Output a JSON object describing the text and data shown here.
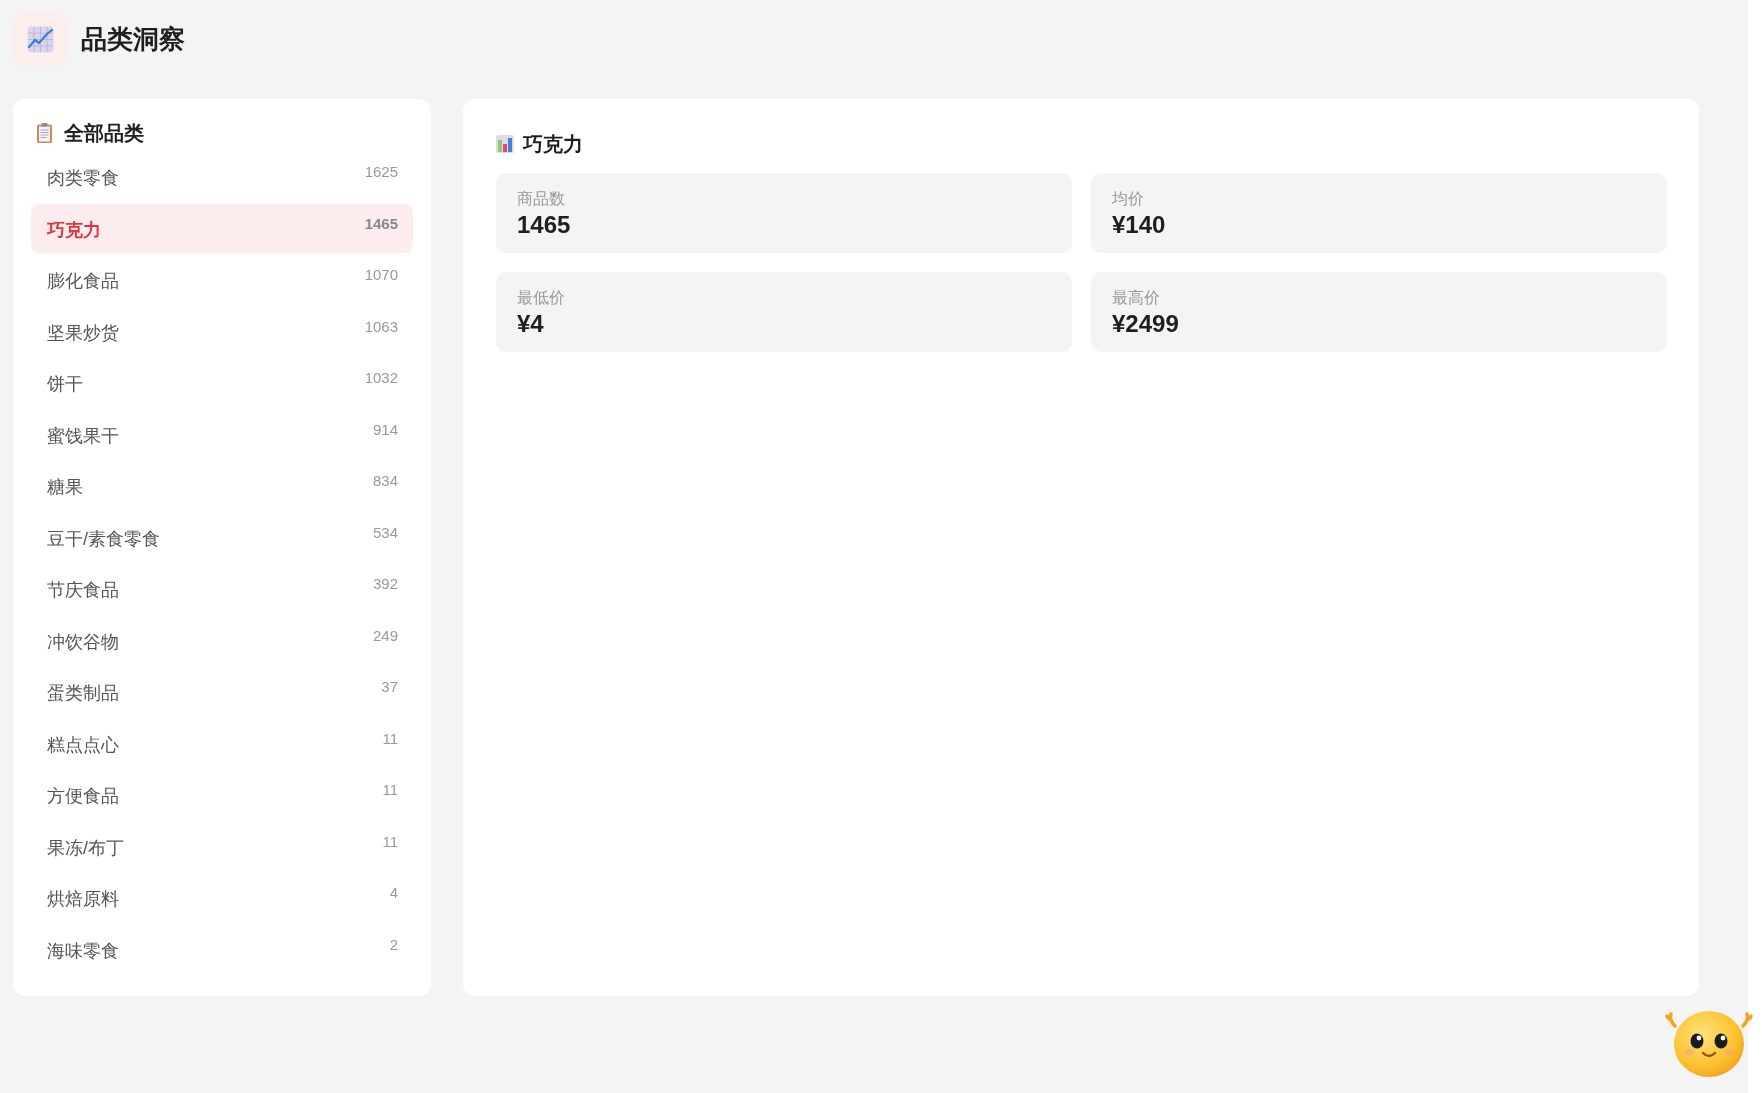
{
  "header": {
    "title": "品类洞察"
  },
  "sidebar": {
    "title": "全部品类",
    "items": [
      {
        "name": "肉类零食",
        "count": "1625",
        "selected": false
      },
      {
        "name": "巧克力",
        "count": "1465",
        "selected": true
      },
      {
        "name": "膨化食品",
        "count": "1070",
        "selected": false
      },
      {
        "name": "坚果炒货",
        "count": "1063",
        "selected": false
      },
      {
        "name": "饼干",
        "count": "1032",
        "selected": false
      },
      {
        "name": "蜜饯果干",
        "count": "914",
        "selected": false
      },
      {
        "name": "糖果",
        "count": "834",
        "selected": false
      },
      {
        "name": "豆干/素食零食",
        "count": "534",
        "selected": false
      },
      {
        "name": "节庆食品",
        "count": "392",
        "selected": false
      },
      {
        "name": "冲饮谷物",
        "count": "249",
        "selected": false
      },
      {
        "name": "蛋类制品",
        "count": "37",
        "selected": false
      },
      {
        "name": "糕点点心",
        "count": "11",
        "selected": false
      },
      {
        "name": "方便食品",
        "count": "11",
        "selected": false
      },
      {
        "name": "果冻/布丁",
        "count": "11",
        "selected": false
      },
      {
        "name": "烘焙原料",
        "count": "4",
        "selected": false
      },
      {
        "name": "海味零食",
        "count": "2",
        "selected": false
      }
    ]
  },
  "detail": {
    "title": "巧克力",
    "stats": [
      {
        "label": "商品数",
        "value": "1465"
      },
      {
        "label": "均价",
        "value": "¥140"
      },
      {
        "label": "最低价",
        "value": "¥4"
      },
      {
        "label": "最高价",
        "value": "¥2499"
      }
    ]
  }
}
